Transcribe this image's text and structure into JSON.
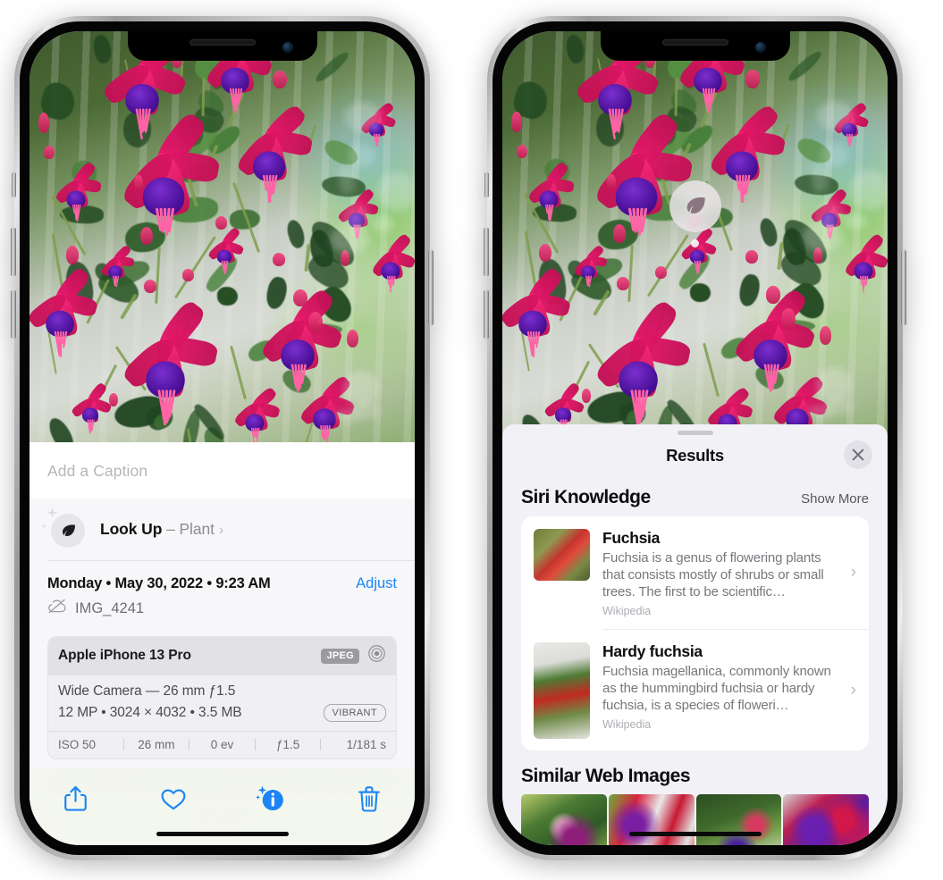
{
  "app": {
    "name": "Photos",
    "screen_left": "Photo Info",
    "screen_right": "Visual Look Up Results"
  },
  "left_phone": {
    "caption": {
      "placeholder": "Add a Caption",
      "value": ""
    },
    "lookup": {
      "label": "Look Up",
      "dash": "–",
      "subject": "Plant",
      "chevron": "›",
      "icon": "leaf-icon"
    },
    "meta": {
      "date": "Monday • May 30, 2022 • 9:23 AM",
      "adjust_label": "Adjust",
      "filename": "IMG_4241",
      "cloud_icon": "icloud-slash-icon"
    },
    "camera": {
      "model": "Apple iPhone 13 Pro",
      "format_badge": "JPEG",
      "aperture_icon": "aperture-icon",
      "lens": "Wide Camera — 26 mm ƒ1.5",
      "resolution": "12 MP • 3024 × 4032 • 3.5 MB",
      "style_badge": "VIBRANT",
      "exif": [
        {
          "label": "ISO 50"
        },
        {
          "label": "26 mm"
        },
        {
          "label": "0 ev"
        },
        {
          "label": "ƒ1.5"
        },
        {
          "label": "1/181 s"
        }
      ]
    },
    "toolbar": [
      {
        "name": "share-button",
        "icon": "share-icon"
      },
      {
        "name": "favorite-button",
        "icon": "heart-icon"
      },
      {
        "name": "info-button",
        "icon": "info-sparkle-icon"
      },
      {
        "name": "delete-button",
        "icon": "trash-icon"
      }
    ],
    "accent_color": "#1b85f3"
  },
  "right_phone": {
    "badge": {
      "icon": "leaf-icon",
      "label": "Visual Look Up plant badge"
    },
    "sheet": {
      "title": "Results",
      "close_label": "✕",
      "grabber": "drag-handle"
    },
    "siri_knowledge": {
      "title": "Siri Knowledge",
      "show_more": "Show More",
      "items": [
        {
          "title": "Fuchsia",
          "description": "Fuchsia is a genus of flowering plants that consists mostly of shrubs or small trees. The first to be scientific…",
          "source": "Wikipedia",
          "chevron": "›"
        },
        {
          "title": "Hardy fuchsia",
          "description": "Fuchsia magellanica, commonly known as the hummingbird fuchsia or hardy fuchsia, is a species of floweri…",
          "source": "Wikipedia",
          "chevron": "›"
        }
      ]
    },
    "similar_web_images": {
      "title": "Similar Web Images",
      "count": 4
    }
  }
}
